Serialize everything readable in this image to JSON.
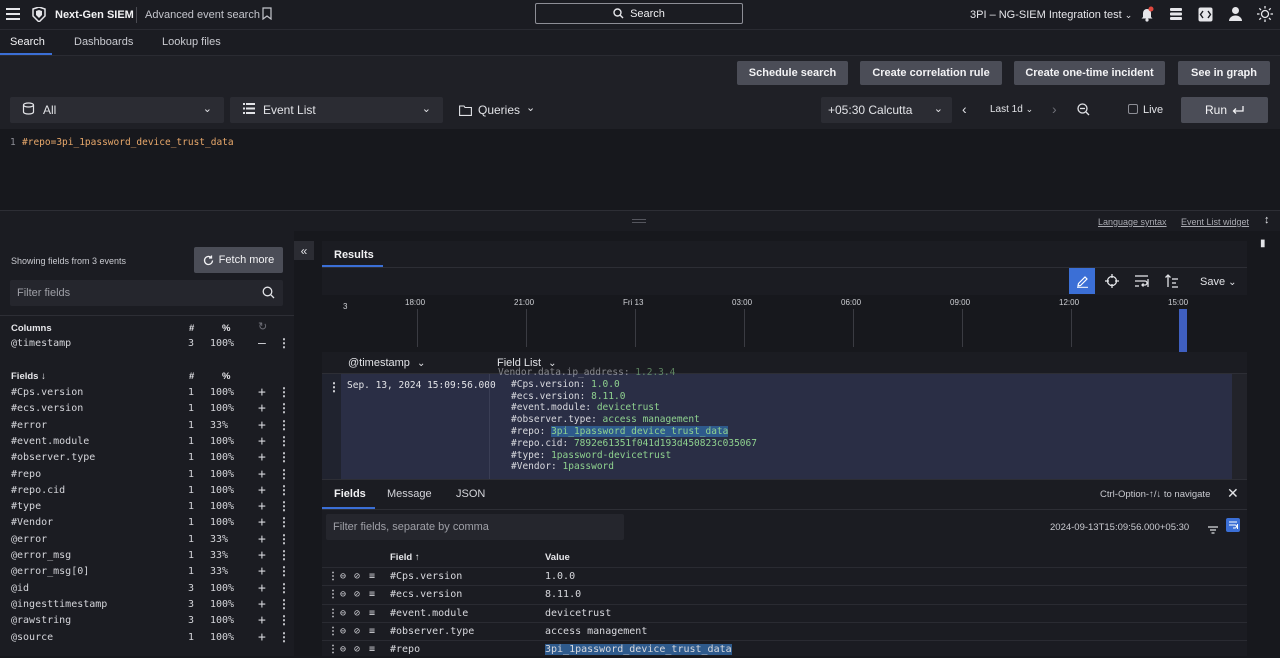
{
  "topbar": {
    "app_name": "Next-Gen SIEM",
    "page_name": "Advanced event search",
    "search_label": "Search",
    "tenant": "3PI – NG-SIEM Integration test"
  },
  "nav_tabs": [
    "Search",
    "Dashboards",
    "Lookup files"
  ],
  "actions": {
    "schedule": "Schedule search",
    "correlation": "Create correlation rule",
    "incident": "Create one-time incident",
    "graph": "See in graph"
  },
  "querybar": {
    "repo": "All",
    "view": "Event List",
    "queries": "Queries",
    "timezone": "+05:30 Calcutta",
    "range": "Last 1d",
    "live": "Live",
    "run": "Run"
  },
  "editor": {
    "line_no": "1",
    "query": "#repo=3pi_1password_device_trust_data"
  },
  "splitbar": {
    "language_syntax": "Language syntax",
    "widget": "Event List widget"
  },
  "fields_panel": {
    "showing": "Showing fields from 3 events",
    "fetch_more": "Fetch more",
    "filter_placeholder": "Filter fields",
    "columns_header": "Columns",
    "hash_header": "#",
    "pct_header": "%",
    "columns": [
      {
        "name": "@timestamp",
        "count": "3",
        "pct": "100%"
      }
    ],
    "fields_header": "Fields",
    "fields": [
      {
        "name": "#Cps.version",
        "count": "1",
        "pct": "100%"
      },
      {
        "name": "#ecs.version",
        "count": "1",
        "pct": "100%"
      },
      {
        "name": "#error",
        "count": "1",
        "pct": "33%"
      },
      {
        "name": "#event.module",
        "count": "1",
        "pct": "100%"
      },
      {
        "name": "#observer.type",
        "count": "1",
        "pct": "100%"
      },
      {
        "name": "#repo",
        "count": "1",
        "pct": "100%"
      },
      {
        "name": "#repo.cid",
        "count": "1",
        "pct": "100%"
      },
      {
        "name": "#type",
        "count": "1",
        "pct": "100%"
      },
      {
        "name": "#Vendor",
        "count": "1",
        "pct": "100%"
      },
      {
        "name": "@error",
        "count": "1",
        "pct": "33%"
      },
      {
        "name": "@error_msg",
        "count": "1",
        "pct": "33%"
      },
      {
        "name": "@error_msg[0]",
        "count": "1",
        "pct": "33%"
      },
      {
        "name": "@id",
        "count": "3",
        "pct": "100%"
      },
      {
        "name": "@ingesttimestamp",
        "count": "3",
        "pct": "100%"
      },
      {
        "name": "@rawstring",
        "count": "3",
        "pct": "100%"
      },
      {
        "name": "@source",
        "count": "1",
        "pct": "100%"
      }
    ]
  },
  "results": {
    "tab": "Results",
    "save": "Save",
    "y_label": "3",
    "time_ticks": [
      "18:00",
      "21:00",
      "Fri 13",
      "03:00",
      "06:00",
      "09:00",
      "12:00",
      "15:00"
    ],
    "histogram_bar_fraction": 1.0,
    "col_timestamp": "@timestamp",
    "col_fieldlist": "Field List",
    "event_timestamp": "Sep. 13, 2024 15:09:56.000",
    "event_lines": [
      {
        "k": "Vendor.data.ip_address:",
        "v": "1.2.3.4"
      },
      {
        "k": "#Cps.version:",
        "v": "1.0.0"
      },
      {
        "k": "#ecs.version:",
        "v": "8.11.0"
      },
      {
        "k": "#event.module:",
        "v": "devicetrust"
      },
      {
        "k": "#observer.type:",
        "v": "access management"
      },
      {
        "k": "#repo:",
        "v": "3pi_1password_device_trust_data"
      },
      {
        "k": "#repo.cid:",
        "v": "7892e61351f041d193d450823c035067"
      },
      {
        "k": "#type:",
        "v": "1password-devicetrust"
      },
      {
        "k": "#Vendor:",
        "v": "1password"
      }
    ]
  },
  "details": {
    "tabs": [
      "Fields",
      "Message",
      "JSON"
    ],
    "navigate_hint": "Ctrl-Option-↑/↓ to navigate",
    "filter_placeholder": "Filter fields, separate by comma",
    "timestamp": "2024-09-13T15:09:56.000+05:30",
    "col_field": "Field",
    "col_value": "Value",
    "rows": [
      {
        "field": "#Cps.version",
        "value": "1.0.0"
      },
      {
        "field": "#ecs.version",
        "value": "8.11.0"
      },
      {
        "field": "#event.module",
        "value": "devicetrust"
      },
      {
        "field": "#observer.type",
        "value": "access management"
      },
      {
        "field": "#repo",
        "value": "3pi_1password_device_trust_data"
      }
    ]
  },
  "colors": {
    "accent": "#3b6fd6",
    "highlight": "#2e5a8c",
    "histogram_bar": "#3f5fc0",
    "value_green": "#8fd28f"
  }
}
